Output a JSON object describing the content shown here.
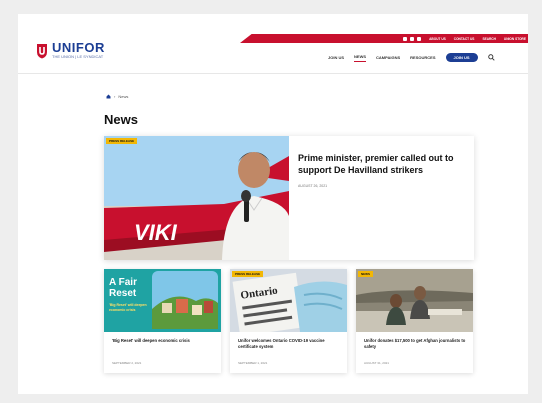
{
  "header": {
    "brand": "UNIFOR",
    "tagline": "THE UNION | LE SYNDICAT",
    "topbar_links": [
      "About Us",
      "Contact Us",
      "Search",
      "Union Store"
    ],
    "nav": [
      "Join Us",
      "News",
      "Campaigns",
      "Resources"
    ],
    "active_nav": "News",
    "donate_label": "Join Us"
  },
  "breadcrumb": {
    "home": "⌂",
    "separator": "›",
    "current": "News"
  },
  "page_title": "News",
  "featured": {
    "tag": "Press Release",
    "title": "Prime minister, premier called out to support De Havilland strikers",
    "date": "August 26, 2021",
    "image_text": "VIKI"
  },
  "cards": [
    {
      "title": "'Big Reset' will deepen economic crisis",
      "date": "September 2, 2021",
      "promo_line1": "A Fair",
      "promo_line2": "Reset",
      "promo_sub": "'Big Reset' will deepen economic crisis"
    },
    {
      "tag": "Press Release",
      "title": "Unifor welcomes Ontario COVID-19 vaccine certificate system",
      "date": "September 1, 2021",
      "image_text": "Ontario"
    },
    {
      "tag": "News",
      "title": "Unifor donates $17,500 to get Afghan journalists to safety",
      "date": "August 31, 2021"
    }
  ],
  "colors": {
    "brand_blue": "#1c3e94",
    "brand_red": "#c8102e",
    "tag_yellow": "#f2b705"
  }
}
